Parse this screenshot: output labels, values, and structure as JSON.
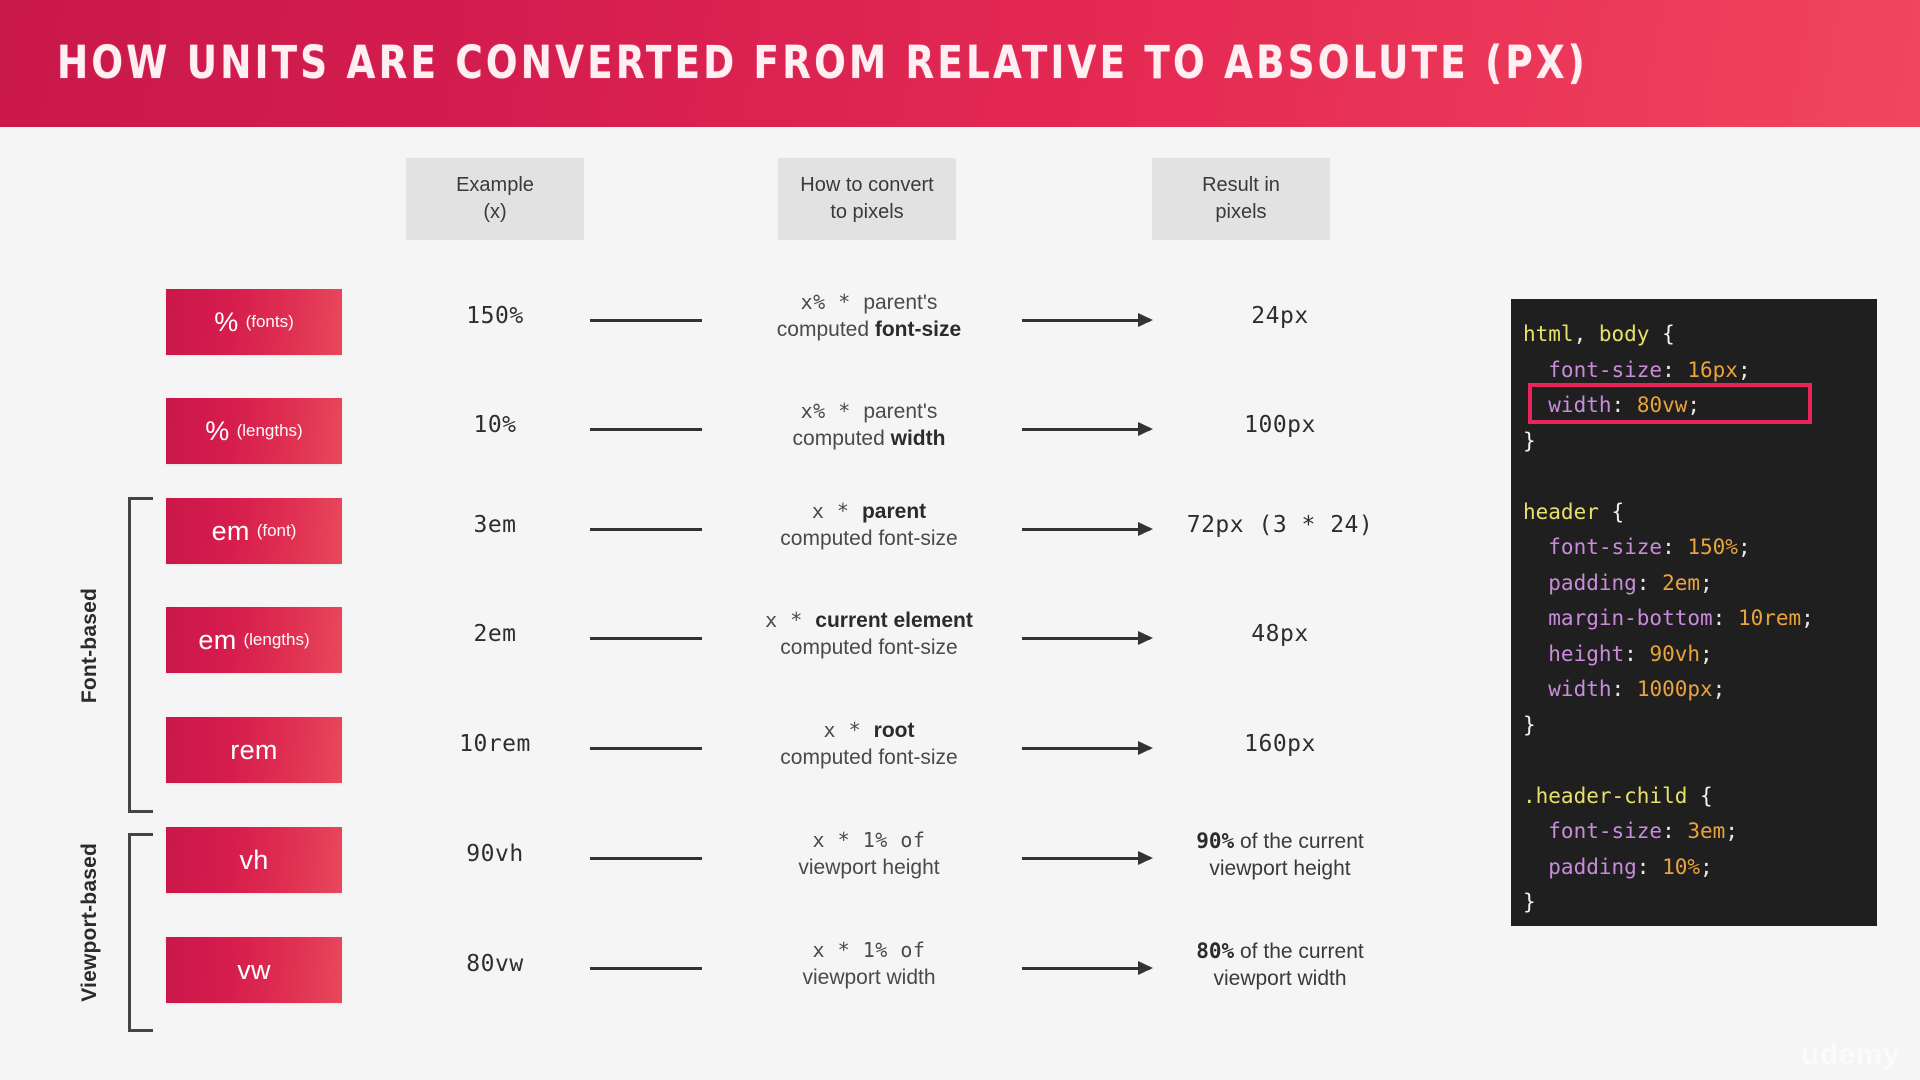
{
  "title": "How units are converted from relative to absolute (px)",
  "theme": {
    "header_gradient_start": "#c9184a",
    "header_gradient_end": "#f0455f",
    "pill_gradient_start": "#c9184a",
    "pill_gradient_end": "#e8485c",
    "page_bg": "#f6f5f5",
    "chip_bg": "#e2e2e2",
    "code_bg": "#201f1f",
    "highlight_border": "#e8245b"
  },
  "columns": {
    "example": {
      "line1": "Example",
      "line2": "(x)"
    },
    "convert": {
      "line1": "How to convert",
      "line2": "to pixels"
    },
    "result": {
      "line1": "Result in",
      "line2": "pixels"
    }
  },
  "groups": [
    {
      "label": "Font-based"
    },
    {
      "label": "Viewport-based"
    }
  ],
  "rows": [
    {
      "unit_main": "%",
      "unit_sub": "(fonts)",
      "example": "150%",
      "formula_mono": "x%",
      "formula_op": "*",
      "formula_target": "parent's",
      "formula_target_bold": false,
      "formula_line2_prefix": "computed ",
      "formula_line2_bold": "font-size",
      "result": "24px",
      "result_kind": "mono"
    },
    {
      "unit_main": "%",
      "unit_sub": "(lengths)",
      "example": "10%",
      "formula_mono": "x%",
      "formula_op": "*",
      "formula_target": "parent's",
      "formula_target_bold": false,
      "formula_line2_prefix": "computed ",
      "formula_line2_bold": "width",
      "result": "100px",
      "result_kind": "mono"
    },
    {
      "unit_main": "em",
      "unit_sub": "(font)",
      "example": "3em",
      "formula_mono": "x",
      "formula_op": "*",
      "formula_target": "parent",
      "formula_target_bold": true,
      "formula_line2_prefix": "computed font-size",
      "formula_line2_bold": "",
      "result": "72px (3 * 24)",
      "result_kind": "mono"
    },
    {
      "unit_main": "em",
      "unit_sub": "(lengths)",
      "example": "2em",
      "formula_mono": "x",
      "formula_op": "*",
      "formula_target": "current element",
      "formula_target_bold": true,
      "formula_line2_prefix": "computed font-size",
      "formula_line2_bold": "",
      "result": "48px",
      "result_kind": "mono"
    },
    {
      "unit_main": "rem",
      "unit_sub": "",
      "example": "10rem",
      "formula_mono": "x",
      "formula_op": "*",
      "formula_target": "root",
      "formula_target_bold": true,
      "formula_line2_prefix": "computed font-size",
      "formula_line2_bold": "",
      "result": "160px",
      "result_kind": "mono"
    },
    {
      "unit_main": "vh",
      "unit_sub": "",
      "example": "90vh",
      "formula_mono": "x",
      "formula_op": "*",
      "formula_target": "1% of",
      "formula_target_bold": false,
      "formula_target_mono": true,
      "formula_line2_prefix": "viewport height",
      "formula_line2_bold": "",
      "result_pct": "90%",
      "result_rest": " of the current",
      "result_line2": "viewport height",
      "result_kind": "text"
    },
    {
      "unit_main": "vw",
      "unit_sub": "",
      "example": "80vw",
      "formula_mono": "x",
      "formula_op": "*",
      "formula_target": "1% of",
      "formula_target_bold": false,
      "formula_target_mono": true,
      "formula_line2_prefix": "viewport width",
      "formula_line2_bold": "",
      "result_pct": "80%",
      "result_rest": " of the current",
      "result_line2": "viewport width",
      "result_kind": "text"
    }
  ],
  "code": {
    "lines": [
      [
        {
          "t": "html",
          "c": "sel"
        },
        {
          "t": ", ",
          "c": "punc"
        },
        {
          "t": "body",
          "c": "sel"
        },
        {
          "t": " {",
          "c": "brace"
        }
      ],
      [
        {
          "t": "  font-size",
          "c": "prop"
        },
        {
          "t": ": ",
          "c": "punc"
        },
        {
          "t": "16px",
          "c": "val"
        },
        {
          "t": ";",
          "c": "punc"
        }
      ],
      [
        {
          "t": "  width",
          "c": "prop"
        },
        {
          "t": ": ",
          "c": "punc"
        },
        {
          "t": "80vw",
          "c": "val"
        },
        {
          "t": ";",
          "c": "punc"
        }
      ],
      [
        {
          "t": "}",
          "c": "brace"
        }
      ],
      [
        {
          "t": "",
          "c": "punc"
        }
      ],
      [
        {
          "t": "header",
          "c": "sel"
        },
        {
          "t": " {",
          "c": "brace"
        }
      ],
      [
        {
          "t": "  font-size",
          "c": "prop"
        },
        {
          "t": ": ",
          "c": "punc"
        },
        {
          "t": "150%",
          "c": "val"
        },
        {
          "t": ";",
          "c": "punc"
        }
      ],
      [
        {
          "t": "  padding",
          "c": "prop"
        },
        {
          "t": ": ",
          "c": "punc"
        },
        {
          "t": "2em",
          "c": "val"
        },
        {
          "t": ";",
          "c": "punc"
        }
      ],
      [
        {
          "t": "  margin-bottom",
          "c": "prop"
        },
        {
          "t": ": ",
          "c": "punc"
        },
        {
          "t": "10rem",
          "c": "val"
        },
        {
          "t": ";",
          "c": "punc"
        }
      ],
      [
        {
          "t": "  height",
          "c": "prop"
        },
        {
          "t": ": ",
          "c": "punc"
        },
        {
          "t": "90vh",
          "c": "val"
        },
        {
          "t": ";",
          "c": "punc"
        }
      ],
      [
        {
          "t": "  width",
          "c": "prop"
        },
        {
          "t": ": ",
          "c": "punc"
        },
        {
          "t": "1000px",
          "c": "val"
        },
        {
          "t": ";",
          "c": "punc"
        }
      ],
      [
        {
          "t": "}",
          "c": "brace"
        }
      ],
      [
        {
          "t": "",
          "c": "punc"
        }
      ],
      [
        {
          "t": ".header-child",
          "c": "sel"
        },
        {
          "t": " {",
          "c": "brace"
        }
      ],
      [
        {
          "t": "  font-size",
          "c": "prop"
        },
        {
          "t": ": ",
          "c": "punc"
        },
        {
          "t": "3em",
          "c": "val"
        },
        {
          "t": ";",
          "c": "punc"
        }
      ],
      [
        {
          "t": "  padding",
          "c": "prop"
        },
        {
          "t": ": ",
          "c": "punc"
        },
        {
          "t": "10%",
          "c": "val"
        },
        {
          "t": ";",
          "c": "punc"
        }
      ],
      [
        {
          "t": "}",
          "c": "brace"
        }
      ]
    ],
    "highlighted_line_index": 2
  },
  "watermark": "udemy"
}
